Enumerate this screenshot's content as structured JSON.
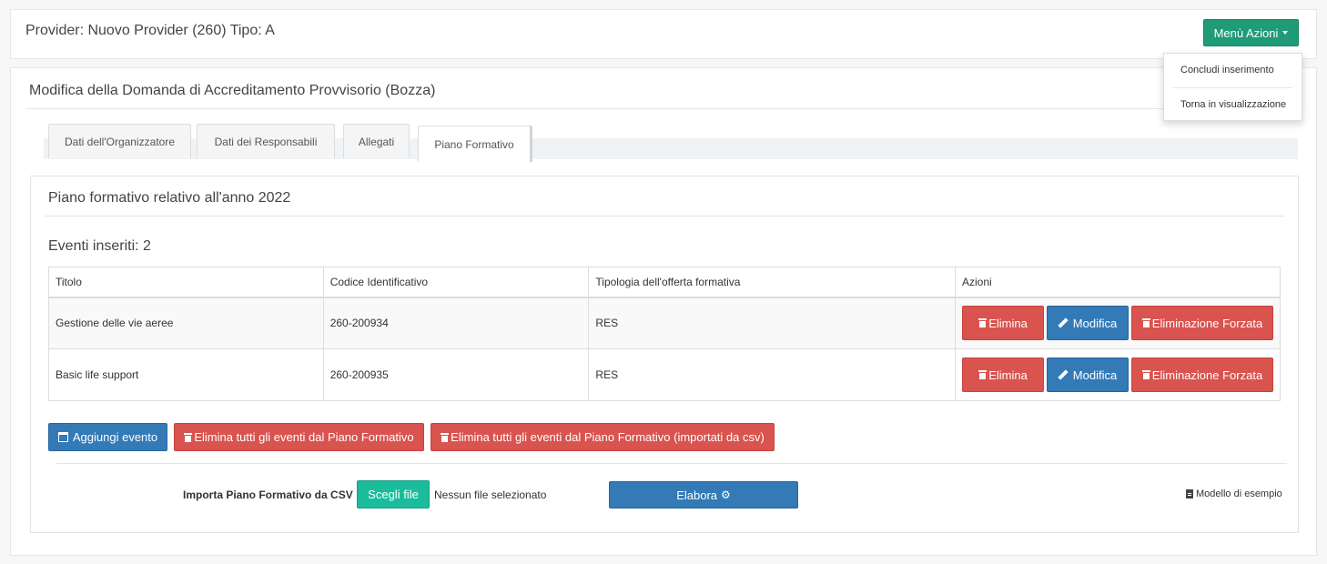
{
  "header": {
    "title": "Provider: Nuovo Provider (260) Tipo: A",
    "menu_label": "Menù Azioni"
  },
  "dropdown": {
    "items": [
      "Concludi inserimento",
      "Torna in visualizzazione"
    ]
  },
  "main": {
    "title": "Modifica della Domanda di Accreditamento Provvisorio (Bozza)",
    "tabs": [
      {
        "label": "Dati dell'Organizzatore"
      },
      {
        "label": "Dati dei Responsabili"
      },
      {
        "label": "Allegati"
      },
      {
        "label": "Piano Formativo",
        "active": true
      }
    ]
  },
  "piano": {
    "title": "Piano formativo relativo all'anno 2022",
    "events_count": "Eventi inseriti: 2",
    "columns": [
      "Titolo",
      "Codice Identificativo",
      "Tipologia dell'offerta formativa",
      "Azioni"
    ],
    "rows": [
      {
        "titolo": "Gestione delle vie aeree",
        "codice": "260-200934",
        "tipo": "RES"
      },
      {
        "titolo": "Basic life support",
        "codice": "260-200935",
        "tipo": "RES"
      }
    ],
    "row_actions": {
      "elimina": "Elimina",
      "modifica": "Modifica",
      "forzata": "Eliminazione Forzata"
    },
    "buttons": {
      "add": "Aggiungi evento",
      "delete_all": "Elimina tutti gli eventi dal Piano Formativo",
      "delete_csv": "Elimina tutti gli eventi dal Piano Formativo (importati da csv)"
    },
    "import": {
      "label": "Importa Piano Formativo da CSV",
      "file_button": "Scegli file",
      "file_status": "Nessun file selezionato",
      "process": "Elabora",
      "model_link": "Modello di esempio"
    }
  },
  "colors": {
    "accent_green": "#1f9b78",
    "danger": "#d9534f",
    "primary": "#337ab7",
    "file_green": "#1abc9c"
  }
}
